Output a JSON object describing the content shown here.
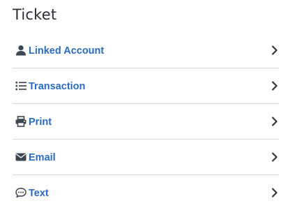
{
  "page": {
    "title": "Ticket"
  },
  "colors": {
    "label": "#2a6cc4",
    "icon": "#3d4550",
    "chevron": "#33383d",
    "divider": "#d9d9d9"
  },
  "menu": {
    "items": [
      {
        "label": "Linked Account",
        "icon": "user-icon"
      },
      {
        "label": "Transaction",
        "icon": "list-icon"
      },
      {
        "label": "Print",
        "icon": "printer-icon"
      },
      {
        "label": "Email",
        "icon": "envelope-icon"
      },
      {
        "label": "Text",
        "icon": "chat-bubble-icon"
      }
    ]
  }
}
